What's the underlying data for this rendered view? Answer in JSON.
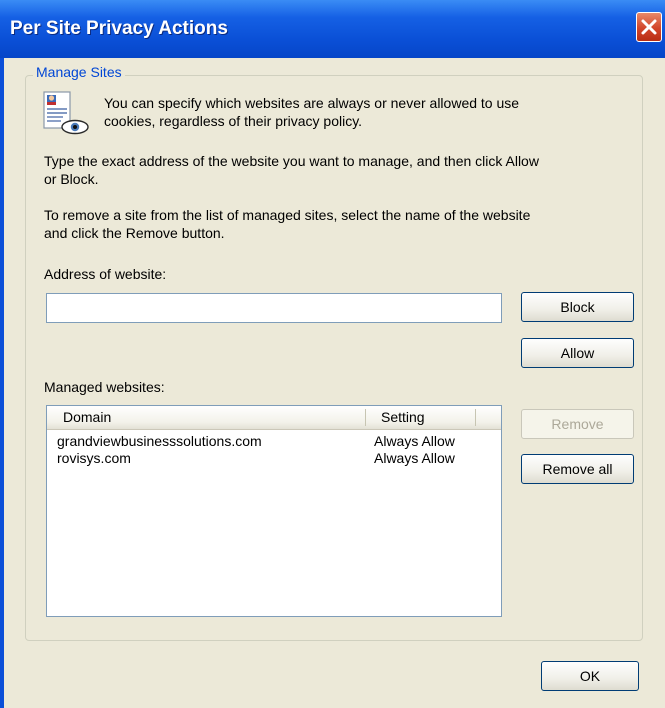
{
  "window": {
    "title": "Per Site Privacy Actions"
  },
  "group": {
    "legend": "Manage Sites"
  },
  "text": {
    "intro_line1": "You can specify which websites are always or never allowed to use",
    "intro_line2": "cookies, regardless of their privacy policy.",
    "instr1_line1": "Type the exact address of the website you want to manage, and then click Allow",
    "instr1_line2": "or Block.",
    "instr2_line1": "To remove a site from the list of managed sites, select the name of the website",
    "instr2_line2": "and click the Remove button.",
    "address_label": "Address of website:",
    "managed_label": "Managed websites:"
  },
  "address_input": {
    "value": ""
  },
  "buttons": {
    "block": "Block",
    "allow": "Allow",
    "remove": "Remove",
    "remove_all": "Remove all",
    "ok": "OK"
  },
  "list": {
    "columns": [
      "Domain",
      "Setting"
    ],
    "rows": [
      {
        "domain": "grandviewbusinesssolutions.com",
        "setting": "Always Allow"
      },
      {
        "domain": "rovisys.com",
        "setting": "Always Allow"
      }
    ]
  },
  "icons": {
    "close": "close-icon",
    "policy_doc": "privacy-document-icon"
  }
}
